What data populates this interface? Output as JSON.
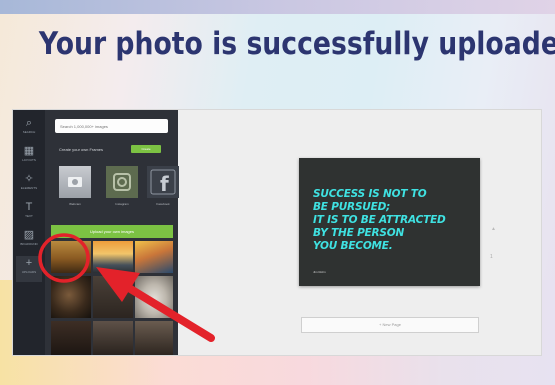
{
  "slide": {
    "headline": "Your photo is successfully uploaded"
  },
  "rail": {
    "items": [
      {
        "icon": "search-icon",
        "glyph": "⌕",
        "label": "SEARCH"
      },
      {
        "icon": "layouts-icon",
        "glyph": "▦",
        "label": "LAYOUTS"
      },
      {
        "icon": "elements-icon",
        "glyph": "✧",
        "label": "ELEMENTS"
      },
      {
        "icon": "text-icon",
        "glyph": "T",
        "label": "TEXT"
      },
      {
        "icon": "background-icon",
        "glyph": "▨",
        "label": "BKGROUND"
      },
      {
        "icon": "uploads-icon",
        "glyph": "+",
        "label": "UPLOADS"
      }
    ]
  },
  "panel": {
    "search_placeholder": "Search 1,000,000+ images",
    "grid_label": "Create your own Frames",
    "grid_button": "Create",
    "sources": [
      {
        "caption": "Webcam"
      },
      {
        "caption": "Instagram"
      },
      {
        "caption": "Facebook"
      }
    ],
    "upload_button": "Upload your own images"
  },
  "canvas": {
    "quote_lines": [
      "SUCCESS IS NOT TO",
      "BE PURSUED;",
      "IT IS TO BE ATTRACTED",
      "BY THE PERSON",
      "YOU BECOME."
    ],
    "author": "Jim Rohn",
    "page_number": "1",
    "new_page_label": "+ New Page",
    "quote_color": "#3fe2e2"
  },
  "annotation": {
    "arrow_color": "#e3222a",
    "circle_color": "#e3222a"
  }
}
